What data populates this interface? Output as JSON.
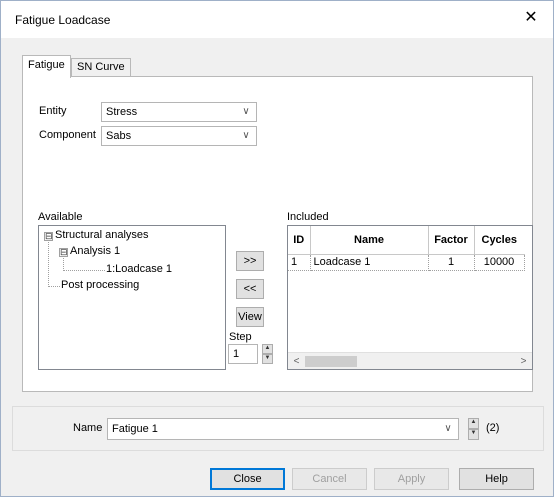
{
  "window": {
    "title": "Fatigue Loadcase",
    "close_glyph": "✕"
  },
  "tabs": [
    {
      "label": "Fatigue",
      "active": true
    },
    {
      "label": "SN Curve",
      "active": false
    }
  ],
  "entity": {
    "label": "Entity",
    "value": "Stress"
  },
  "component": {
    "label": "Component",
    "value": "Sabs"
  },
  "available": {
    "label": "Available",
    "tree": {
      "root": "Structural analyses",
      "analysis": "Analysis 1",
      "loadcase": "1:Loadcase 1",
      "post": "Post processing"
    }
  },
  "transfer": {
    "add_label": ">>",
    "remove_label": "<<",
    "view_label": "View",
    "step_label": "Step",
    "step_value": "1"
  },
  "included": {
    "label": "Included",
    "columns": [
      "ID",
      "Name",
      "Factor",
      "Cycles"
    ],
    "rows": [
      {
        "id": "1",
        "name": "Loadcase 1",
        "factor": "1",
        "cycles": "10000"
      }
    ]
  },
  "name_field": {
    "label": "Name",
    "value": "Fatigue 1",
    "count": "(2)"
  },
  "buttons": {
    "close": "Close",
    "cancel": "Cancel",
    "apply": "Apply",
    "help": "Help"
  },
  "colors": {
    "accent": "#0078d7",
    "disabled_text": "#a0a0a0"
  },
  "icons": {
    "expand": "⊟",
    "chevron": "∨",
    "spin_up": "▲",
    "spin_down": "▼",
    "scroll_left": "<",
    "scroll_right": ">"
  }
}
